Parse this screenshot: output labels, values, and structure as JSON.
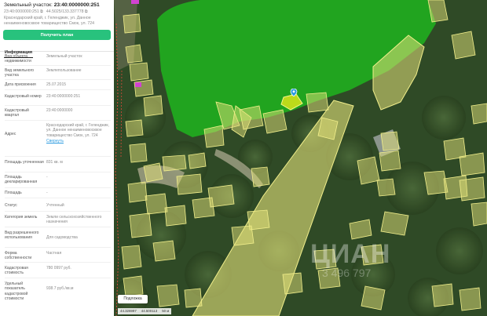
{
  "panel": {
    "title_prefix": "Земельный участок:",
    "cadastral_number": "23:40:0000000:251",
    "coords_left": "23:40:0000000:251 ⧉",
    "coords_right": "44.5025/133.337778 ⧉",
    "address": "Краснодарский край, г. Геленджик, ул. Данное ненаименовосквое товарищество Смок, ул. 724",
    "plan_button": "Получить план",
    "tab_info": "Информация"
  },
  "info_rows": [
    {
      "label": "Вид объекта недвижимости",
      "value": "Земельный участок"
    },
    {
      "label": "Вид земельного участка",
      "value": "Землепользование"
    },
    {
      "label": "Дата присвоения",
      "value": "25.07.2015"
    },
    {
      "label": "Кадастровый номер",
      "value": "23:40:0000000:251"
    },
    {
      "label": "Кадастровый квартал",
      "value": "23:40:0000000"
    },
    {
      "label": "Адрес",
      "value": "Краснодарский край, г. Геленджик, ул. Данное ненаименовосквое товарищество Смок, ул. 724",
      "link": "Свернуть"
    },
    {
      "label": "Площадь уточненная",
      "value": "831 кв. м"
    },
    {
      "label": "Площадь декларированная",
      "value": "-"
    },
    {
      "label": "Площадь",
      "value": "-"
    },
    {
      "label": "Статус",
      "value": "Учтенный"
    },
    {
      "label": "Категория земель",
      "value": "Земли сельскохозяйственного назначения"
    },
    {
      "label": "Вид разрешенного использования",
      "value": "Для садоводства"
    },
    {
      "label": "Форма собственности",
      "value": "Частная"
    },
    {
      "label": "Кадастровая стоимость",
      "value": "780 0997 руб."
    },
    {
      "label": "Удельный показатель кадастровой стоимости",
      "value": "938.7 руб./кв.м"
    }
  ],
  "map": {
    "layers_label": "Подложка",
    "scale_left": "44.326997",
    "scale_mid": "44.500113",
    "scale_right": "50 м",
    "watermark": "ЦИАН",
    "watermark_sub": "3 496 797",
    "colors": {
      "forest": "#2f4a26",
      "green_zone": "#1fb81f",
      "parcel_fill": "#e4e27a",
      "parcel_stroke": "#f2ef8c",
      "selected": "#d7e41a",
      "marker": "#2a9ae0",
      "accent": "#28c27d"
    },
    "marker_icon": "location-pin-icon"
  }
}
